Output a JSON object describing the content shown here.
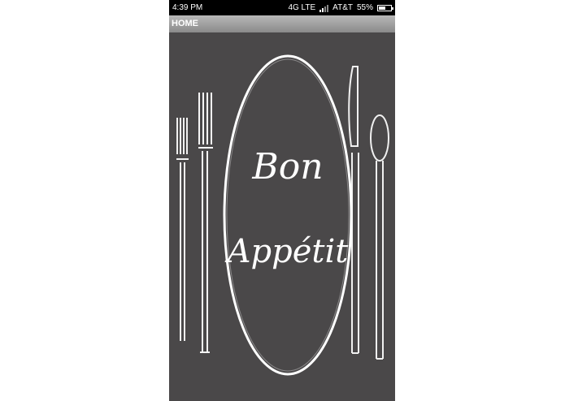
{
  "status_bar": {
    "time": "4:39 PM",
    "network": "4G LTE",
    "carrier": "AT&T",
    "battery": "55%",
    "battery_level": 0.55,
    "signal_bars_active": 2
  },
  "header": {
    "title": "HOME"
  },
  "hero": {
    "line1": "Bon",
    "line2": "Appétit"
  },
  "colors": {
    "background": "#4a4849",
    "chalk": "#ffffff",
    "status_bar": "#000000"
  }
}
